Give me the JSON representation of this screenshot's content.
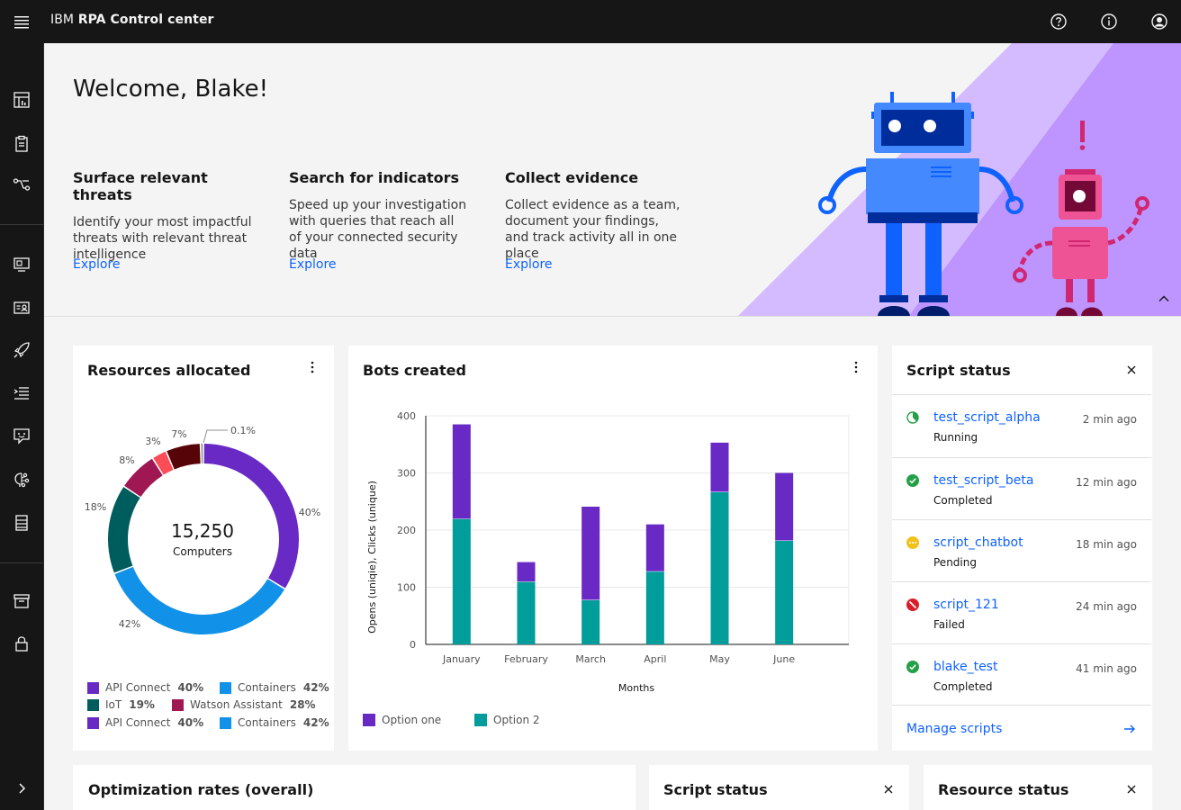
{
  "header": {
    "brand_prefix": "IBM",
    "brand_name": "RPA Control center"
  },
  "hero": {
    "title": "Welcome, Blake!",
    "features": [
      {
        "title": "Surface relevant threats",
        "body": "Identify your most impactful threats with relevant threat intelligence",
        "link": "Explore"
      },
      {
        "title": "Search for indicators",
        "body": "Speed up your investigation with queries that reach all of your connected security data",
        "link": "Explore"
      },
      {
        "title": "Collect evidence",
        "body": "Collect evidence as a team, document your findings, and track activity all in one place",
        "link": "Explore"
      }
    ]
  },
  "resources": {
    "title": "Resources allocated",
    "total": "15,250",
    "total_label": "Computers",
    "colors": {
      "api_connect": "#6929c4",
      "containers": "#1192e8",
      "iot": "#005d5d",
      "watson": "#9f1853",
      "red": "#fa4d56",
      "darkred": "#570408",
      "gray": "#8d8d8d"
    },
    "slice_labels": [
      "40%",
      "42%",
      "18%",
      "8%",
      "3%",
      "7%",
      "0.1%"
    ],
    "legend": [
      {
        "name": "API Connect",
        "pct": "40%",
        "color": "#6929c4"
      },
      {
        "name": "Containers",
        "pct": "42%",
        "color": "#1192e8"
      },
      {
        "name": "IoT",
        "pct": "19%",
        "color": "#005d5d"
      },
      {
        "name": "Watson Assistant",
        "pct": "28%",
        "color": "#9f1853"
      },
      {
        "name": "API Connect",
        "pct": "40%",
        "color": "#6929c4"
      },
      {
        "name": "Containers",
        "pct": "42%",
        "color": "#1192e8"
      }
    ]
  },
  "bots": {
    "title": "Bots created",
    "option_one": "Option one",
    "option_two": "Option 2"
  },
  "script_status": {
    "title": "Script status",
    "items": [
      {
        "name": "test_script_alpha",
        "state": "Running",
        "time": "2 min ago"
      },
      {
        "name": "test_script_beta",
        "state": "Completed",
        "time": "12 min ago"
      },
      {
        "name": "script_chatbot",
        "state": "Pending",
        "time": "18 min ago"
      },
      {
        "name": "script_121",
        "state": "Failed",
        "time": "24 min ago"
      },
      {
        "name": "blake_test",
        "state": "Completed",
        "time": "41 min ago"
      }
    ],
    "manage_label": "Manage scripts"
  },
  "bottom": {
    "optimization_title": "Optimization rates (overall)",
    "script_status_title": "Script status",
    "resource_status_title": "Resource status"
  },
  "chart_data": {
    "type": "bar",
    "stacked": true,
    "title": "Bots created",
    "categories": [
      "January",
      "February",
      "March",
      "April",
      "May",
      "June"
    ],
    "series": [
      {
        "name": "Option 2",
        "color": "#009d9a",
        "values": [
          220,
          110,
          78,
          128,
          267,
          182
        ]
      },
      {
        "name": "Option one",
        "color": "#6929c4",
        "values": [
          165,
          34,
          163,
          82,
          86,
          118
        ]
      }
    ],
    "xlabel": "Months",
    "ylabel": "Opens (uniqie), Clicks (unique)",
    "ylim": [
      0,
      400
    ],
    "yticks": [
      0,
      100,
      200,
      300,
      400
    ],
    "grid": true,
    "legend": "bottom-left"
  }
}
